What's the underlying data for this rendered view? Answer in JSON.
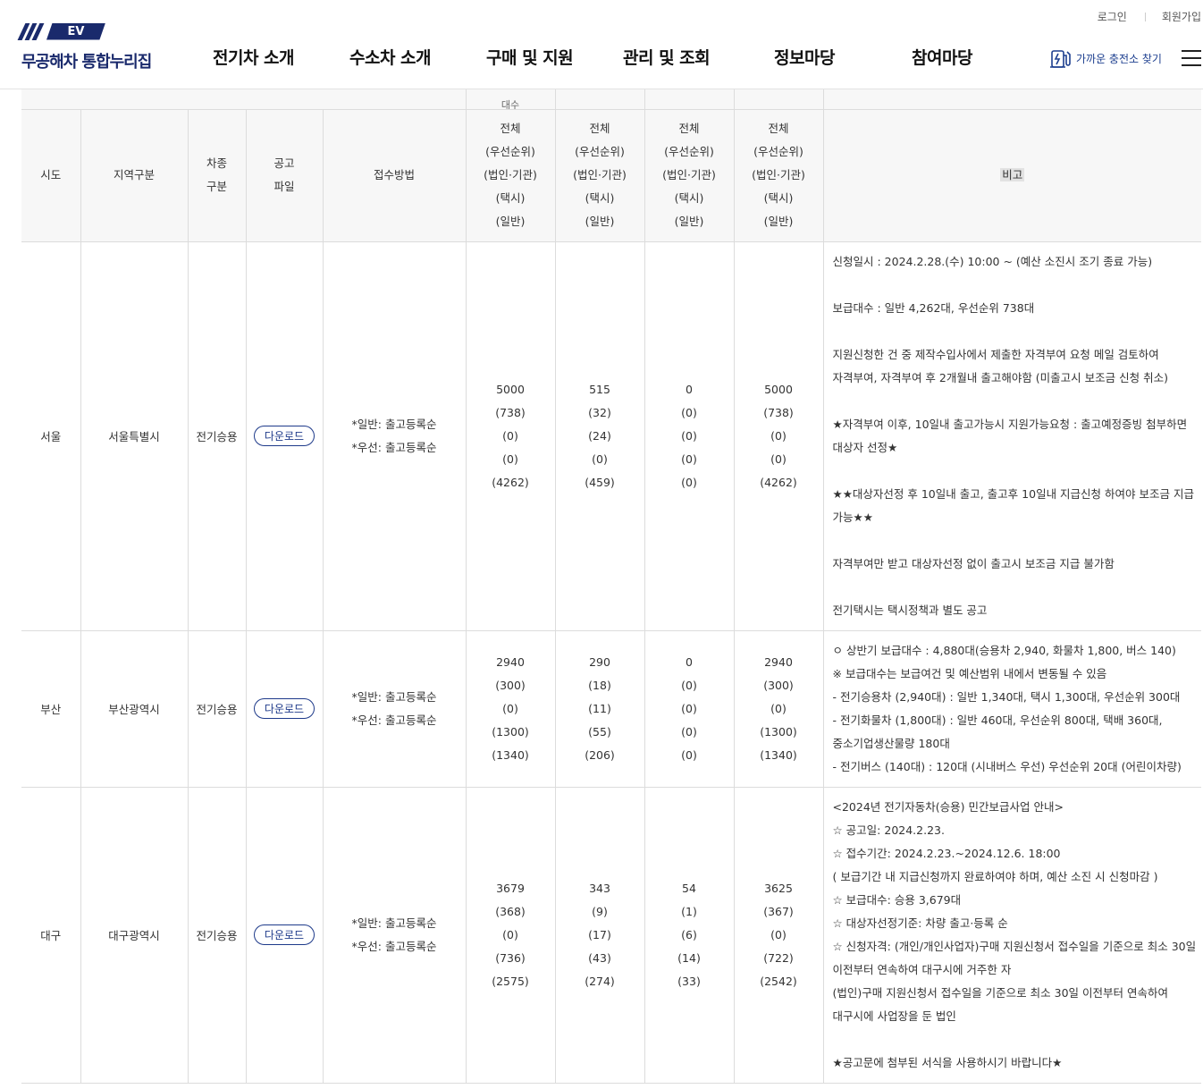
{
  "header": {
    "logo_mark": "EV",
    "logo_text": "무공해차 통합누리집",
    "util_links": [
      "로그인",
      "회원가입"
    ],
    "nav": [
      "전기차 소개",
      "수소차 소개",
      "구매 및 지원",
      "관리 및 조회",
      "정보마당",
      "참여마당"
    ],
    "charger_link": "가까운 충전소 찾기",
    "menu_icon": "hamburger-icon",
    "brand_color": "#1a2a6c"
  },
  "table": {
    "cut_header_text": "대수",
    "columns": {
      "sido": "시도",
      "region": "지역구분",
      "car_type": [
        "차종",
        "구분"
      ],
      "notice": [
        "공고",
        "파일"
      ],
      "method": "접수방법",
      "sub": [
        "전체",
        "(우선순위)",
        "(법인·기관)",
        "(택시)",
        "(일반)"
      ],
      "remark": "비고"
    },
    "rows": [
      {
        "sido": "서울",
        "region": "서울특별시",
        "car_type": "전기승용",
        "download": "다운로드",
        "method": [
          "*일반: 출고등록순",
          "*우선: 출고등록순"
        ],
        "groups": [
          [
            "5000",
            "(738)",
            "(0)",
            "(0)",
            "(4262)"
          ],
          [
            "515",
            "(32)",
            "(24)",
            "(0)",
            "(459)"
          ],
          [
            "0",
            "(0)",
            "(0)",
            "(0)",
            "(0)"
          ],
          [
            "5000",
            "(738)",
            "(0)",
            "(0)",
            "(4262)"
          ]
        ],
        "notes": [
          "신청일시 : 2024.2.28.(수) 10:00 ~ (예산 소진시 조기 종료 가능)",
          "",
          "보급대수 : 일반 4,262대, 우선순위 738대",
          "",
          "지원신청한 건 중 제작수입사에서 제출한 자격부여 요청 메일 검토하여",
          "자격부여, 자격부여 후 2개월내 출고해야함 (미출고시 보조금 신청 취소)",
          "",
          "★자격부여 이후, 10일내 출고가능시 지원가능요청 : 출고예정증빙 첨부하면",
          "대상자 선정★",
          "",
          "★★대상자선정 후 10일내 출고, 출고후 10일내 지급신청 하여야 보조금 지급",
          "가능★★",
          "",
          "자격부여만 받고 대상자선정 없이 출고시 보조금 지급 불가함",
          "",
          "전기택시는 택시정책과 별도 공고"
        ]
      },
      {
        "sido": "부산",
        "region": "부산광역시",
        "car_type": "전기승용",
        "download": "다운로드",
        "method": [
          "*일반: 출고등록순",
          "*우선: 출고등록순"
        ],
        "groups": [
          [
            "2940",
            "(300)",
            "(0)",
            "(1300)",
            "(1340)"
          ],
          [
            "290",
            "(18)",
            "(11)",
            "(55)",
            "(206)"
          ],
          [
            "0",
            "(0)",
            "(0)",
            "(0)",
            "(0)"
          ],
          [
            "2940",
            "(300)",
            "(0)",
            "(1300)",
            "(1340)"
          ]
        ],
        "notes": [
          "ㅇ 상반기 보급대수 : 4,880대(승용차 2,940, 화물차 1,800, 버스 140)",
          "※ 보급대수는 보급여건 및 예산범위 내에서 변동될 수 있음",
          "- 전기승용차 (2,940대) : 일반 1,340대, 택시 1,300대, 우선순위 300대",
          "- 전기화물차 (1,800대) : 일반 460대, 우선순위 800대, 택배 360대,",
          "중소기업생산물량 180대",
          "- 전기버스 (140대) : 120대 (시내버스 우선) 우선순위 20대 (어린이차량)"
        ]
      },
      {
        "sido": "대구",
        "region": "대구광역시",
        "car_type": "전기승용",
        "download": "다운로드",
        "method": [
          "*일반: 출고등록순",
          "*우선: 출고등록순"
        ],
        "groups": [
          [
            "3679",
            "(368)",
            "(0)",
            "(736)",
            "(2575)"
          ],
          [
            "343",
            "(9)",
            "(17)",
            "(43)",
            "(274)"
          ],
          [
            "54",
            "(1)",
            "(6)",
            "(14)",
            "(33)"
          ],
          [
            "3625",
            "(367)",
            "(0)",
            "(722)",
            "(2542)"
          ]
        ],
        "notes": [
          "<2024년 전기자동차(승용) 민간보급사업 안내>",
          "☆ 공고일: 2024.2.23.",
          "☆ 접수기간: 2024.2.23.~2024.12.6. 18:00",
          "( 보급기간 내 지급신청까지 완료하여야 하며, 예산 소진 시 신청마감 )",
          "☆ 보급대수: 승용 3,679대",
          "☆ 대상자선정기준: 차량 출고·등록 순",
          "☆ 신청자격: (개인/개인사업자)구매 지원신청서 접수일을 기준으로 최소 30일",
          "이전부터 연속하여 대구시에 거주한 자",
          "(법인)구매 지원신청서 접수일을 기준으로 최소 30일 이전부터 연속하여",
          "대구시에 사업장을 둔 법인",
          "",
          "★공고문에 첨부된 서식을 사용하시기 바랍니다★"
        ]
      }
    ]
  }
}
